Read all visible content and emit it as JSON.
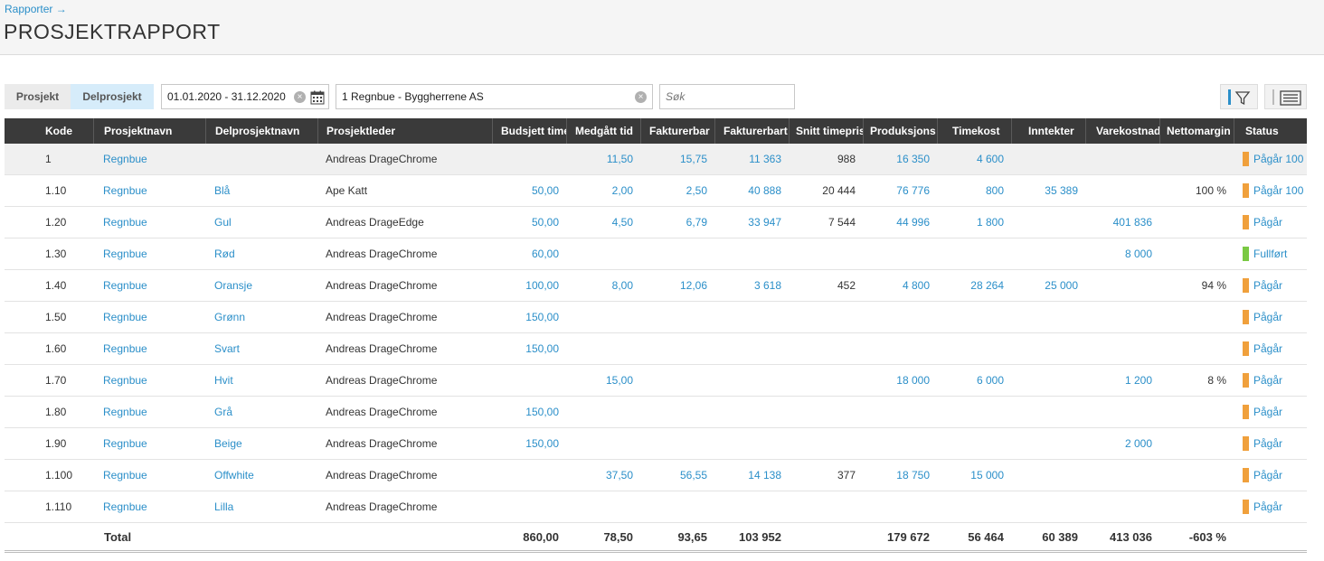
{
  "header": {
    "breadcrumb": "Rapporter →",
    "title": "PROSJEKTRAPPORT"
  },
  "toolbar": {
    "segments": [
      "Prosjekt",
      "Delprosjekt"
    ],
    "selected_segment": "Delprosjekt",
    "date_range": "01.01.2020 - 31.12.2020",
    "project": "1 Regnbue - Byggherrene AS",
    "search_placeholder": "Søk"
  },
  "colors": {
    "header_bg": "#3a3a3a",
    "link": "#2b8fc9",
    "status_ongoing": "#f0a03c",
    "status_done": "#7ac943",
    "selected_segment_bg": "#d6ecfa"
  },
  "table": {
    "columns": [
      "Kode",
      "Prosjektnavn",
      "Delprosjektnavn",
      "Prosjektleder",
      "Budsjett timer",
      "Medgått tid",
      "Fakturerbar",
      "Fakturerbart",
      "Snitt timepris",
      "Produksjons",
      "Timekost",
      "Inntekter",
      "Varekostnad",
      "Nettomargin",
      "Status"
    ],
    "rows": [
      {
        "kode": "1",
        "prosjektnavn": "Regnbue",
        "delprosjektnavn": "",
        "prosjektleder": "Andreas DrageChrome",
        "budsjett": "",
        "medgatt": "11,50",
        "fakturerbar": "15,75",
        "fakturerbart": "11 363",
        "snitt": "988",
        "produksjon": "16 350",
        "timekost": "4 600",
        "inntekter": "",
        "varekostnad": "",
        "nettomargin": "",
        "status": "Pågår 100",
        "status_color": "#f0a03c"
      },
      {
        "kode": "1.10",
        "prosjektnavn": "Regnbue",
        "delprosjektnavn": "Blå",
        "prosjektleder": "Ape Katt",
        "budsjett": "50,00",
        "medgatt": "2,00",
        "fakturerbar": "2,50",
        "fakturerbart": "40 888",
        "snitt": "20 444",
        "produksjon": "76 776",
        "timekost": "800",
        "inntekter": "35 389",
        "varekostnad": "",
        "nettomargin": "100 %",
        "status": "Pågår 100",
        "status_color": "#f0a03c"
      },
      {
        "kode": "1.20",
        "prosjektnavn": "Regnbue",
        "delprosjektnavn": "Gul",
        "prosjektleder": "Andreas DrageEdge",
        "budsjett": "50,00",
        "medgatt": "4,50",
        "fakturerbar": "6,79",
        "fakturerbart": "33 947",
        "snitt": "7 544",
        "produksjon": "44 996",
        "timekost": "1 800",
        "inntekter": "",
        "varekostnad": "401 836",
        "nettomargin": "",
        "status": "Pågår",
        "status_color": "#f0a03c"
      },
      {
        "kode": "1.30",
        "prosjektnavn": "Regnbue",
        "delprosjektnavn": "Rød",
        "prosjektleder": "Andreas DrageChrome",
        "budsjett": "60,00",
        "medgatt": "",
        "fakturerbar": "",
        "fakturerbart": "",
        "snitt": "",
        "produksjon": "",
        "timekost": "",
        "inntekter": "",
        "varekostnad": "8 000",
        "nettomargin": "",
        "status": "Fullført",
        "status_color": "#7ac943"
      },
      {
        "kode": "1.40",
        "prosjektnavn": "Regnbue",
        "delprosjektnavn": "Oransje",
        "prosjektleder": "Andreas DrageChrome",
        "budsjett": "100,00",
        "medgatt": "8,00",
        "fakturerbar": "12,06",
        "fakturerbart": "3 618",
        "snitt": "452",
        "produksjon": "4 800",
        "timekost": "28 264",
        "inntekter": "25 000",
        "varekostnad": "",
        "nettomargin": "94 %",
        "status": "Pågår",
        "status_color": "#f0a03c"
      },
      {
        "kode": "1.50",
        "prosjektnavn": "Regnbue",
        "delprosjektnavn": "Grønn",
        "prosjektleder": "Andreas DrageChrome",
        "budsjett": "150,00",
        "medgatt": "",
        "fakturerbar": "",
        "fakturerbart": "",
        "snitt": "",
        "produksjon": "",
        "timekost": "",
        "inntekter": "",
        "varekostnad": "",
        "nettomargin": "",
        "status": "Pågår",
        "status_color": "#f0a03c"
      },
      {
        "kode": "1.60",
        "prosjektnavn": "Regnbue",
        "delprosjektnavn": "Svart",
        "prosjektleder": "Andreas DrageChrome",
        "budsjett": "150,00",
        "medgatt": "",
        "fakturerbar": "",
        "fakturerbart": "",
        "snitt": "",
        "produksjon": "",
        "timekost": "",
        "inntekter": "",
        "varekostnad": "",
        "nettomargin": "",
        "status": "Pågår",
        "status_color": "#f0a03c"
      },
      {
        "kode": "1.70",
        "prosjektnavn": "Regnbue",
        "delprosjektnavn": "Hvit",
        "prosjektleder": "Andreas DrageChrome",
        "budsjett": "",
        "medgatt": "15,00",
        "fakturerbar": "",
        "fakturerbart": "",
        "snitt": "",
        "produksjon": "18 000",
        "timekost": "6 000",
        "inntekter": "",
        "varekostnad": "1 200",
        "nettomargin": "8 %",
        "status": "Pågår",
        "status_color": "#f0a03c"
      },
      {
        "kode": "1.80",
        "prosjektnavn": "Regnbue",
        "delprosjektnavn": "Grå",
        "prosjektleder": "Andreas DrageChrome",
        "budsjett": "150,00",
        "medgatt": "",
        "fakturerbar": "",
        "fakturerbart": "",
        "snitt": "",
        "produksjon": "",
        "timekost": "",
        "inntekter": "",
        "varekostnad": "",
        "nettomargin": "",
        "status": "Pågår",
        "status_color": "#f0a03c"
      },
      {
        "kode": "1.90",
        "prosjektnavn": "Regnbue",
        "delprosjektnavn": "Beige",
        "prosjektleder": "Andreas DrageChrome",
        "budsjett": "150,00",
        "medgatt": "",
        "fakturerbar": "",
        "fakturerbart": "",
        "snitt": "",
        "produksjon": "",
        "timekost": "",
        "inntekter": "",
        "varekostnad": "2 000",
        "nettomargin": "",
        "status": "Pågår",
        "status_color": "#f0a03c"
      },
      {
        "kode": "1.100",
        "prosjektnavn": "Regnbue",
        "delprosjektnavn": "Offwhite",
        "prosjektleder": "Andreas DrageChrome",
        "budsjett": "",
        "medgatt": "37,50",
        "fakturerbar": "56,55",
        "fakturerbart": "14 138",
        "snitt": "377",
        "produksjon": "18 750",
        "timekost": "15 000",
        "inntekter": "",
        "varekostnad": "",
        "nettomargin": "",
        "status": "Pågår",
        "status_color": "#f0a03c"
      },
      {
        "kode": "1.110",
        "prosjektnavn": "Regnbue",
        "delprosjektnavn": "Lilla",
        "prosjektleder": "Andreas DrageChrome",
        "budsjett": "",
        "medgatt": "",
        "fakturerbar": "",
        "fakturerbart": "",
        "snitt": "",
        "produksjon": "",
        "timekost": "",
        "inntekter": "",
        "varekostnad": "",
        "nettomargin": "",
        "status": "Pågår",
        "status_color": "#f0a03c"
      }
    ],
    "total": {
      "label": "Total",
      "budsjett": "860,00",
      "medgatt": "78,50",
      "fakturerbar": "93,65",
      "fakturerbart": "103 952",
      "produksjon": "179 672",
      "timekost": "56 464",
      "inntekter": "60 389",
      "varekostnad": "413 036",
      "nettomargin": "-603 %"
    }
  }
}
